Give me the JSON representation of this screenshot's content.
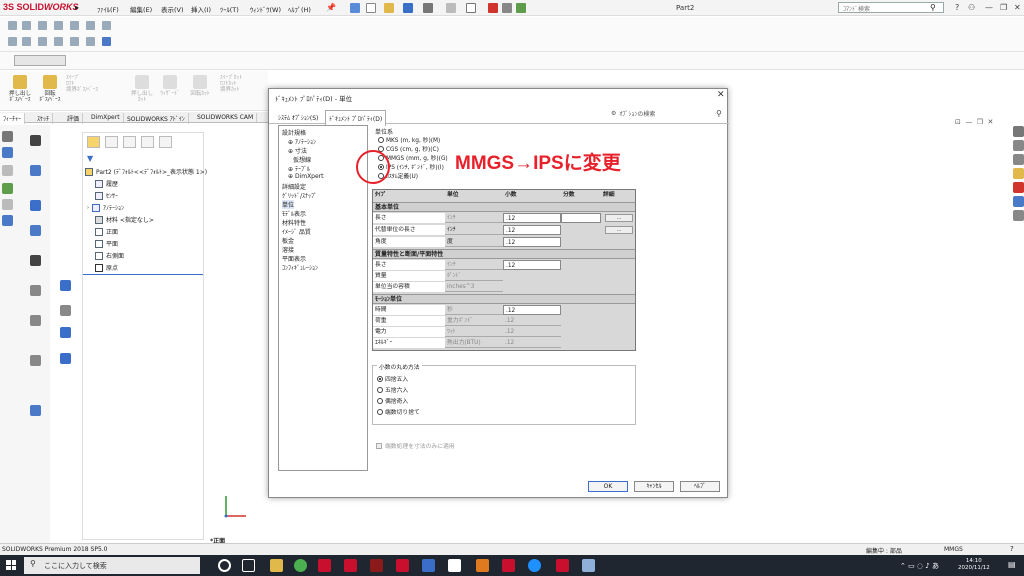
{
  "app": {
    "logo_prefix": "3S",
    "logo_text": "SOLID",
    "logo_italic": "WORKS",
    "doc_title": "Part2",
    "search_placeholder": "ｺﾏﾝﾄﾞ検索"
  },
  "menu": [
    "ﾌｧｲﾙ(F)",
    "編集(E)",
    "表示(V)",
    "挿入(I)",
    "ﾂｰﾙ(T)",
    "ｳｨﾝﾄﾞｳ(W)",
    "ﾍﾙﾌﾟ(H)"
  ],
  "features": [
    {
      "label": "押し出し\nﾎﾞｽ/ﾍﾞｰｽ",
      "dim": false
    },
    {
      "label": "回転\nﾎﾞｽ/ﾍﾞｰｽ",
      "dim": false
    },
    {
      "label": "ｽｲｰﾌﾟ\nﾛﾌﾄ\n境界ﾎﾞｽ/ﾍﾞｰｽ",
      "dim": true
    },
    {
      "label": "押し出し\nｶｯﾄ",
      "dim": true
    },
    {
      "label": "ｳｨｻﾞｰﾄﾞ",
      "dim": true
    },
    {
      "label": "回転ｶｯﾄ",
      "dim": true
    },
    {
      "label": "ｽｲｰﾌﾟｶｯﾄ\nﾛﾌﾄｶｯﾄ\n境界ｶｯﾄ",
      "dim": true
    }
  ],
  "cmd_tabs": [
    "ﾌｨｰﾁｬｰ",
    "ｽｹｯﾁ",
    "評価",
    "DimXpert",
    "SOLIDWORKS ｱﾄﾞｲﾝ",
    "SOLIDWORKS CAM"
  ],
  "feature_tree": {
    "root": "Part2 (ﾃﾞﾌｫﾙﾄ<<ﾃﾞﾌｫﾙﾄ>_表示状態 1>)",
    "items": [
      "履歴",
      "ｾﾝｻｰ",
      "ｱﾉﾃｰｼｮﾝ",
      "材料 <指定なし>",
      "正面",
      "平面",
      "右側面",
      "原点"
    ]
  },
  "dialog": {
    "title": "ﾄﾞｷｭﾒﾝﾄ ﾌﾟﾛﾊﾟﾃｨ(D) - 単位",
    "tabs": [
      "ｼｽﾃﾑ ｵﾌﾟｼｮﾝ(S)",
      "ﾄﾞｷｭﾒﾝﾄ ﾌﾟﾛﾊﾟﾃｨ(D)"
    ],
    "option_search": "ｵﾌﾟｼｮﾝの検索",
    "tree": [
      "設計規格",
      "ｱﾉﾃｰｼｮﾝ",
      "寸法",
      "仮想線",
      "ﾃｰﾌﾞﾙ",
      "DimXpert",
      "詳細設定",
      "ｸﾞﾘｯﾄﾞ/ｽﾅｯﾌﾟ",
      "単位",
      "ﾓﾃﾞﾙ表示",
      "材料特性",
      "ｲﾒｰｼﾞ 品質",
      "板金",
      "溶接",
      "平面表示",
      "ｺﾝﾌｨｷﾞｭﾚｰｼｮﾝ"
    ],
    "unit_system_label": "単位系",
    "unit_systems": [
      {
        "label": "MKS (m, kg, 秒)(M)",
        "selected": false
      },
      {
        "label": "CGS (cm, g, 秒)(C)",
        "selected": false
      },
      {
        "label": "MMGS (mm, g, 秒)(G)",
        "selected": false
      },
      {
        "label": "IPS (ｲﾝﾁ, ﾎﾟﾝﾄﾞ, 秒)(I)",
        "selected": true
      },
      {
        "label": "ｶｽﾀﾑ定義(U)",
        "selected": false
      }
    ],
    "table_headers": [
      "ﾀｲﾌﾟ",
      "単位",
      "小数",
      "分数",
      "詳細"
    ],
    "sections": [
      {
        "title": "基本単位",
        "rows": [
          {
            "type": "長さ",
            "unit": "ｲﾝﾁ",
            "decimals": ".12",
            "more": "..."
          },
          {
            "type": "代替単位の長さ",
            "unit": "ｲﾝﾁ",
            "decimals": ".12",
            "more": "..."
          },
          {
            "type": "角度",
            "unit": "度",
            "decimals": ".12",
            "more": ""
          }
        ]
      },
      {
        "title": "質量特性と断面/平面特性",
        "rows": [
          {
            "type": "長さ",
            "unit": "ｲﾝﾁ",
            "decimals": ".12",
            "more": ""
          },
          {
            "type": "質量",
            "unit": "ﾎﾟﾝﾄﾞ",
            "decimals": "",
            "more": ""
          },
          {
            "type": "単位当の容積",
            "unit": "inches^3",
            "decimals": "",
            "more": ""
          }
        ]
      },
      {
        "title": "ﾓｰｼｮﾝ単位",
        "rows": [
          {
            "type": "時間",
            "unit": "秒",
            "decimals": ".12",
            "more": ""
          },
          {
            "type": "荷重",
            "unit": "重力ﾎﾟﾝﾄﾞ",
            "decimals": ".12",
            "more": ""
          },
          {
            "type": "電力",
            "unit": "ﾜｯﾄ",
            "decimals": ".12",
            "more": ""
          },
          {
            "type": "ｴﾈﾙｷﾞｰ",
            "unit": "熱出力(BTU)",
            "decimals": ".12",
            "more": ""
          }
        ]
      }
    ],
    "rounding_label": "小数の丸め方法",
    "rounding": [
      {
        "label": "四捨五入",
        "selected": true
      },
      {
        "label": "五捨六入",
        "selected": false
      },
      {
        "label": "偶捨奇入",
        "selected": false
      },
      {
        "label": "端数切り捨て",
        "selected": false
      }
    ],
    "apply_only_dims": "端数処理を寸法のみに適用",
    "buttons": {
      "ok": "OK",
      "cancel": "ｷｬﾝｾﾙ",
      "help": "ﾍﾙﾌﾟ"
    }
  },
  "annotation": {
    "text": "MMGS→IPSに変更",
    "color": "#e8202a"
  },
  "viewport": {
    "front_label": "*正面"
  },
  "status": {
    "left": "SOLIDWORKS Premium 2018 SP5.0",
    "editing": "編集中 : 部品",
    "units": "MMGS"
  },
  "taskbar": {
    "search": "ここに入力して検索",
    "time": "14:10",
    "date": "2020/11/12"
  }
}
